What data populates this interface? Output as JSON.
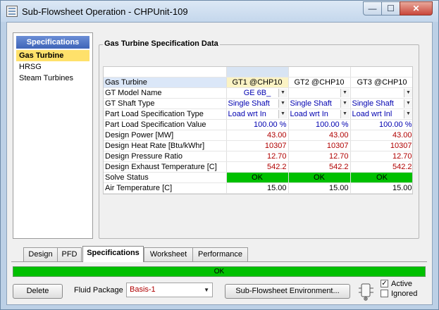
{
  "window": {
    "title": "Sub-Flowsheet Operation - CHPUnit-109",
    "minimize_glyph": "—",
    "maximize_glyph": "☐",
    "close_glyph": "✕"
  },
  "spec_panel": {
    "header": "Specifications",
    "items": [
      "Gas Turbine",
      "HRSG",
      "Steam Turbines"
    ]
  },
  "group": {
    "title": "Gas Turbine Specification Data"
  },
  "grid": {
    "gt_names": [
      "GT1 @CHP10",
      "GT2 @CHP10",
      "GT3 @CHP10"
    ],
    "row_labels": {
      "gas_turbine": "Gas Turbine",
      "model": "GT Model Name",
      "shaft": "GT Shaft Type",
      "part_load_spec": "Part Load Specification Type",
      "part_load_value": "Part Load Specification Value",
      "design_power": "Design Power [MW]",
      "heat_rate": "Design Heat Rate [Btu/kWhr]",
      "pressure_ratio": "Design Pressure Ratio",
      "exhaust_temp": "Design Exhaust Temperature [C]",
      "solve_status": "Solve Status",
      "air_temp": "Air Temperature [C]"
    },
    "model": [
      "GE 6B_",
      "_",
      "_"
    ],
    "shaft": [
      "Single Shaft",
      "Single Shaft",
      "Single Shaft"
    ],
    "part_load_spec": [
      "Load wrt In",
      "Load wrt In",
      "Load wrt Inl"
    ],
    "part_load_value": [
      "100.00 %",
      "100.00 %",
      "100.00 %"
    ],
    "design_power": [
      "43.00",
      "43.00",
      "43.00"
    ],
    "heat_rate": [
      "10307",
      "10307",
      "10307"
    ],
    "pressure_ratio": [
      "12.70",
      "12.70",
      "12.70"
    ],
    "exhaust_temp": [
      "542.2",
      "542.2",
      "542.2"
    ],
    "solve_status": [
      "OK",
      "OK",
      "OK"
    ],
    "air_temp": [
      "15.00",
      "15.00",
      "15.00"
    ]
  },
  "tabs": [
    "Design",
    "PFD",
    "Specifications",
    "Worksheet",
    "Performance"
  ],
  "status_bar": {
    "text": "OK",
    "color": "#00c000"
  },
  "bottom": {
    "delete_label": "Delete",
    "fluid_package_label": "Fluid Package",
    "fluid_package_value": "Basis-1",
    "env_button_label": "Sub-Flowsheet Environment...",
    "active_label": "Active",
    "ignored_label": "Ignored",
    "active_checked_glyph": "✓"
  }
}
